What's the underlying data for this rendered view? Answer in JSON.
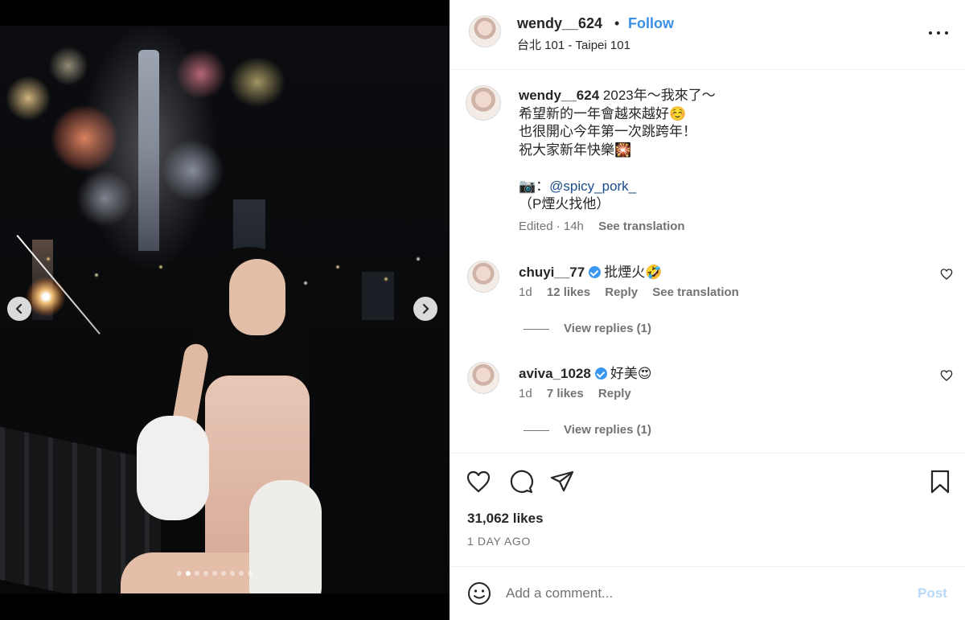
{
  "post": {
    "username": "wendy__624",
    "separator": "•",
    "follow_label": "Follow",
    "location": "台北 101 - Taipei 101"
  },
  "caption": {
    "username": "wendy__624",
    "line1": " 2023年～我來了～",
    "line2": "希望新的一年會越來越好☺️",
    "line3": "也很開心今年第一次跳跨年！",
    "line4": "祝大家新年快樂🎇",
    "line5": "",
    "credit_prefix": "📷：",
    "credit_mention": "@spicy_pork_",
    "line7": "（P煙火找他）",
    "edited": "Edited · 14h",
    "see_translation": "See translation"
  },
  "comments": [
    {
      "username": "chuyi__77",
      "text": "批煙火🤣",
      "age": "1d",
      "likes": "12 likes",
      "reply": "Reply",
      "see_translation": "See translation",
      "view_replies": "View replies (1)"
    },
    {
      "username": "aviva_1028",
      "text": "好美😍",
      "age": "1d",
      "likes": "7 likes",
      "reply": "Reply",
      "view_replies": "View replies (1)"
    }
  ],
  "stats": {
    "likes": "31,062 likes",
    "posted": "1 DAY AGO"
  },
  "composer": {
    "placeholder": "Add a comment...",
    "post_label": "Post"
  },
  "carousel": {
    "total_slides": 9,
    "active_slide": 2
  },
  "colors": {
    "follow": "#3a8fe6",
    "verified": "#3897f0",
    "post_disabled": "#b8d9fb",
    "mention": "#1b4b8a"
  }
}
